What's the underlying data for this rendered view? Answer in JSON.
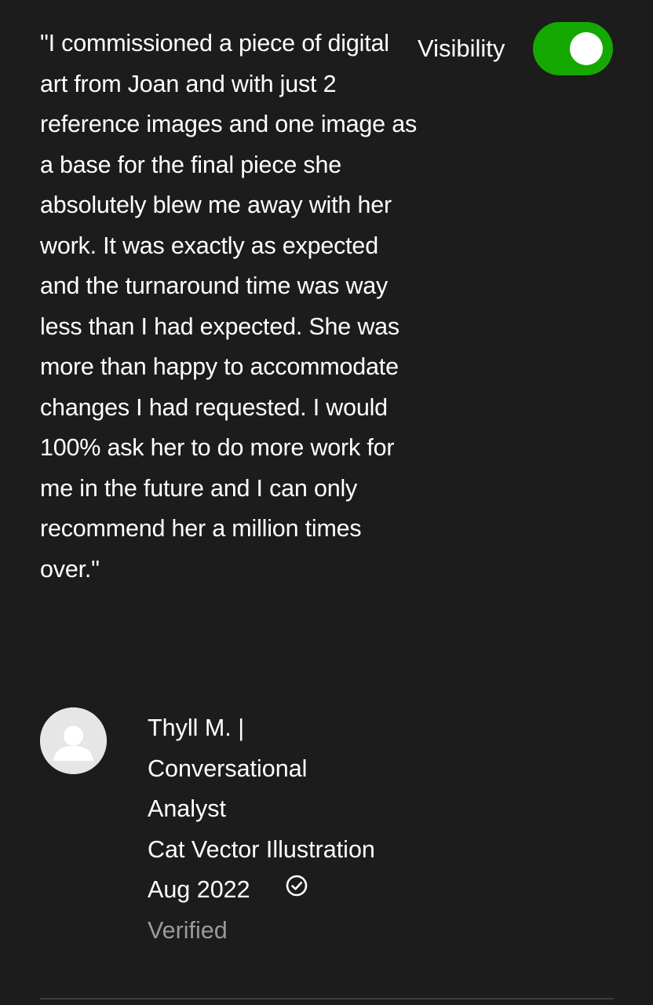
{
  "review": {
    "quote": "\"I commissioned a piece of digital art from Joan and with just 2 reference images and one image as a base for the final piece she absolutely blew me away with her work. It was exactly as expected and the turnaround time was way less than I had expected. She was more than happy to accommodate changes I had requested. I would 100% ask her to do more work for me in the future and I can only recommend her a million times over.\"",
    "visibility_label": "Visibility",
    "visibility_on": true,
    "reviewer_name": "Thyll M. |",
    "reviewer_title_line1": "Conversational",
    "reviewer_title_line2": "Analyst",
    "project": "Cat Vector Illustration",
    "date": "Aug 2022",
    "verified_label": "Verified",
    "icons": {
      "avatar": "user-placeholder-icon",
      "verified": "check-circle-icon"
    },
    "colors": {
      "background": "#1c1c1c",
      "toggle_on": "#14a800",
      "text": "#ffffff",
      "muted": "#9a9a9a"
    }
  }
}
